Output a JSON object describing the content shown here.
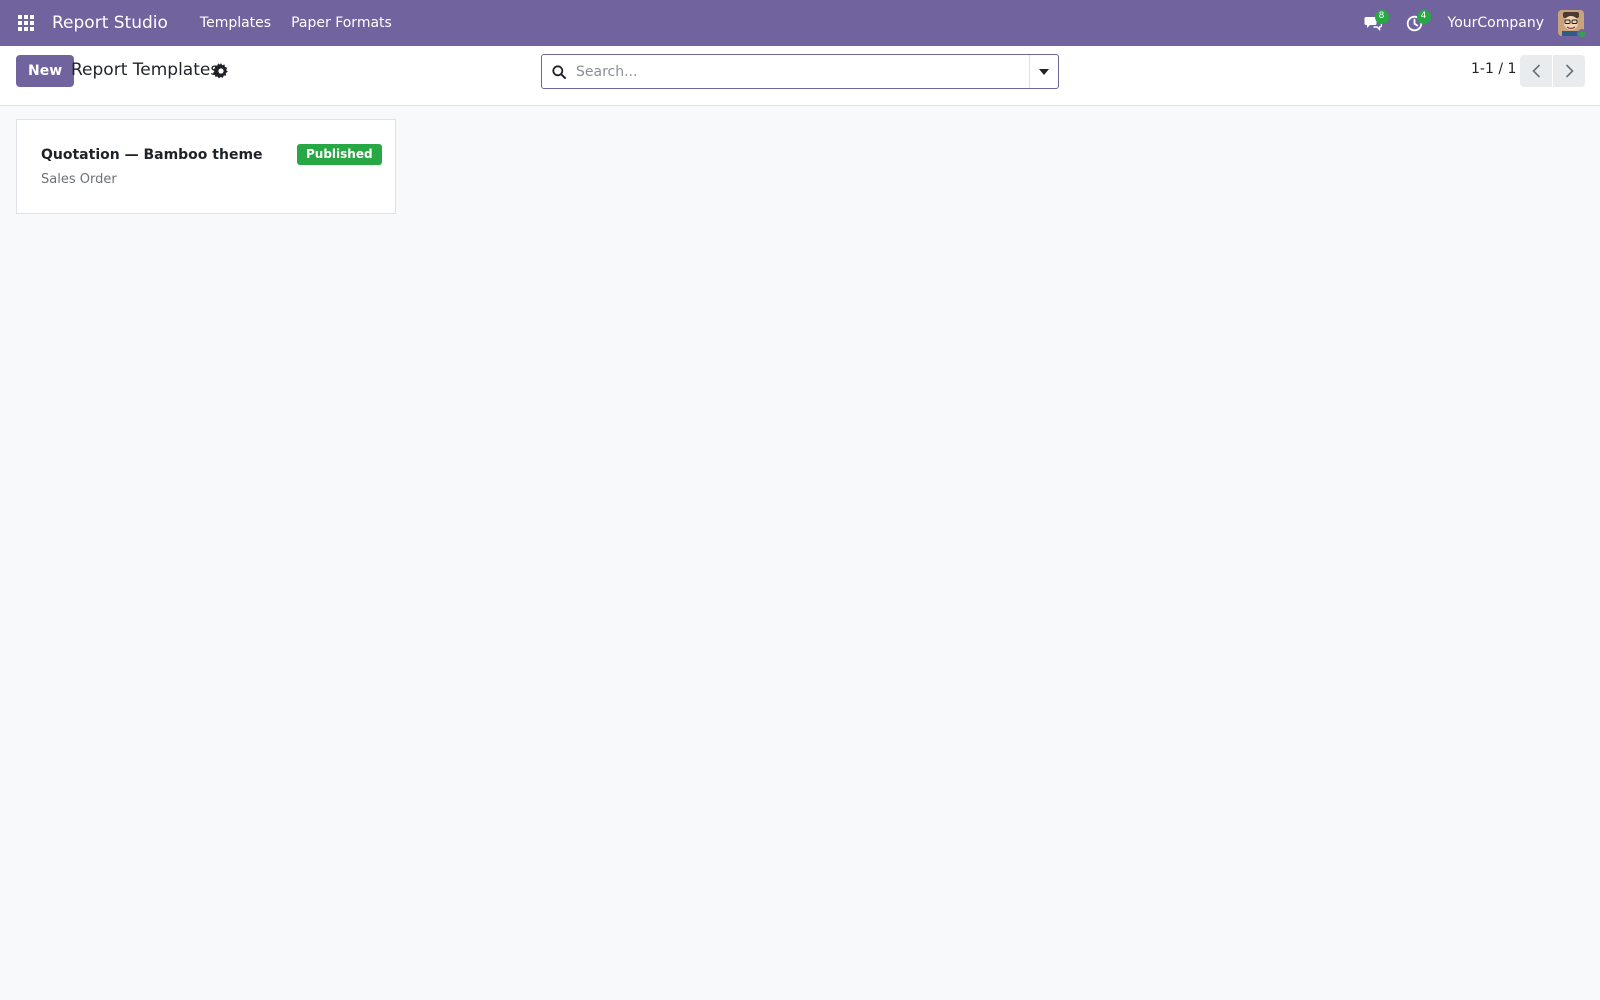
{
  "navbar": {
    "app_title": "Report Studio",
    "menu": [
      {
        "label": "Templates"
      },
      {
        "label": "Paper Formats"
      }
    ],
    "messages_count": "8",
    "activities_count": "4",
    "company": "YourCompany",
    "accent_color": "#71639e"
  },
  "control_panel": {
    "new_label": "New",
    "title": "Report Templates",
    "search_placeholder": "Search...",
    "pager": "1-1 / 1"
  },
  "records": [
    {
      "name": "Quotation — Bamboo theme",
      "model": "Sales Order",
      "status": "Published",
      "status_color": "#28a745"
    }
  ],
  "icons": {
    "apps": "apps-grid-icon",
    "messages": "chat-bubbles-icon",
    "activities": "clock-icon",
    "settings": "gear-icon",
    "search": "search-icon",
    "dropdown": "caret-down-icon",
    "prev": "chevron-left-icon",
    "next": "chevron-right-icon"
  }
}
